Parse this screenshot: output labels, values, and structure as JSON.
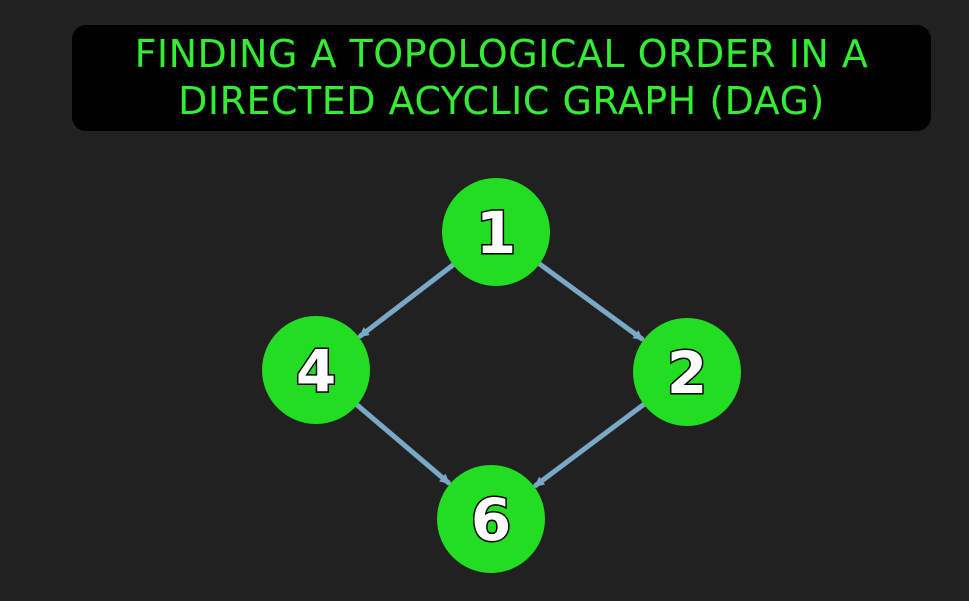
{
  "title": {
    "line1": "FINDING A TOPOLOGICAL ORDER IN A",
    "line2": "DIRECTED ACYCLIC GRAPH (DAG)"
  },
  "colors": {
    "background": "#212121",
    "title_box": "#000000",
    "title_text": "#33ee33",
    "node_fill": "#22dd22",
    "node_label": "#ffffff",
    "edge": "#7aa9c8"
  },
  "graph": {
    "nodes": [
      {
        "id": "n1",
        "label": "1"
      },
      {
        "id": "n4",
        "label": "4"
      },
      {
        "id": "n2",
        "label": "2"
      },
      {
        "id": "n6",
        "label": "6"
      }
    ],
    "edges": [
      {
        "from": "1",
        "to": "4"
      },
      {
        "from": "1",
        "to": "2"
      },
      {
        "from": "4",
        "to": "6"
      },
      {
        "from": "2",
        "to": "6"
      }
    ]
  }
}
